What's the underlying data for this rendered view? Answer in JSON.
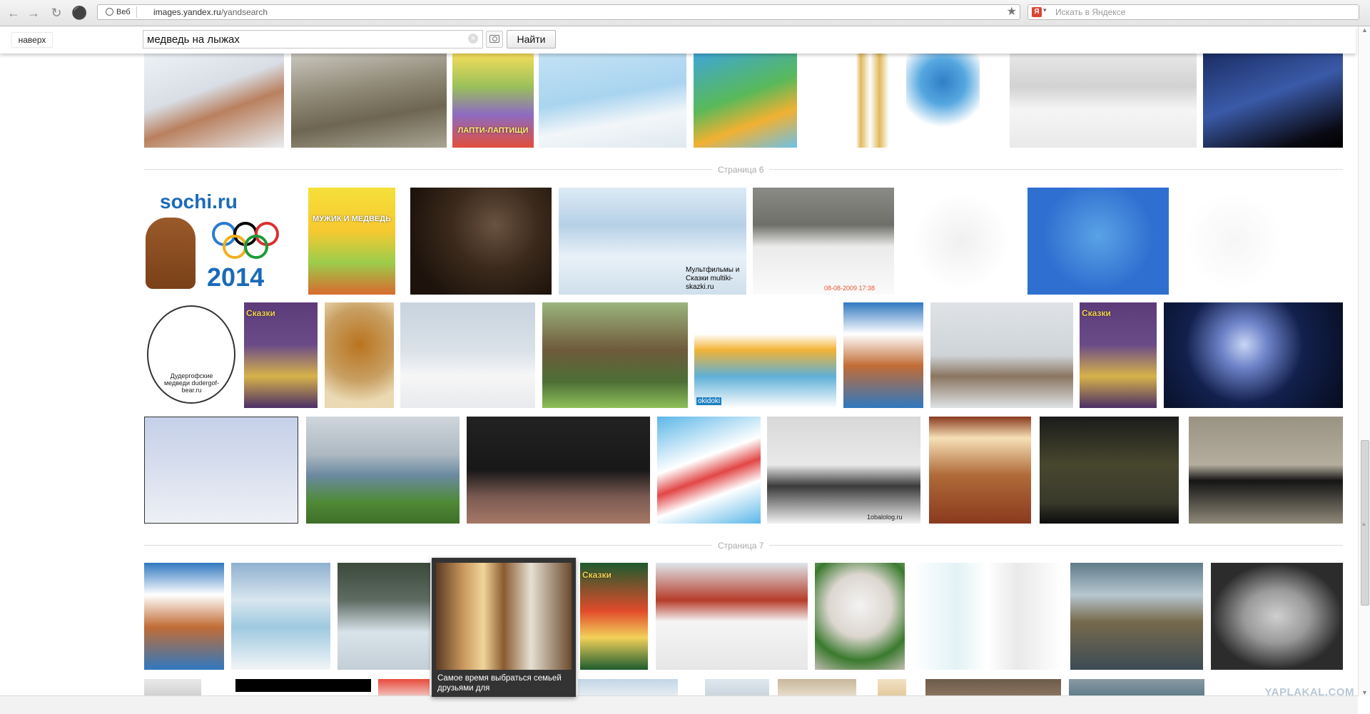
{
  "browser": {
    "web_pill": "Веб",
    "url_domain": "images.yandex.ru",
    "url_path": "/yandsearch",
    "yandex_search_placeholder": "Искать в Яндексе"
  },
  "toolbar": {
    "up_label": "наверх",
    "query": "медведь на лыжах",
    "find_label": "Найти"
  },
  "separators": [
    "Страница 6",
    "Страница 7"
  ],
  "tile_labels": {
    "lapti_title": "ЛАПТИ-ЛАПТИЩИ",
    "sochi_text": "sochi.ru",
    "sochi_year": "2014",
    "muzhik_title": "МУЖИК И МЕДВЕДЬ",
    "multiki": "Мультфильмы и Сказки multiki-skazki.ru",
    "dudergof": "Дудергофские медведи dudergof-bear.ru",
    "skazki": "Сказки",
    "okidoki": "okidoki",
    "cobalt": "1obalolog.ru",
    "timestamp": "08-08-2009 17:38"
  },
  "popup": {
    "caption": "Самое время выбраться семьей друзьями для"
  },
  "watermark": "YAPLAKAL.COM",
  "colors": {
    "separator_line": "#dcdcdc",
    "separator_text": "#aaaaaa",
    "popup_bg": "#333333",
    "yandex_logo": "#dd4433"
  }
}
